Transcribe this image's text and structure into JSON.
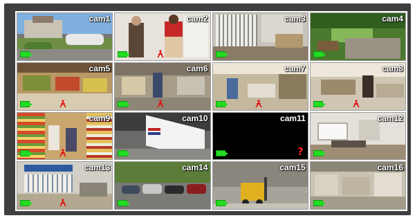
{
  "cameras": [
    {
      "label": "cam1",
      "signal": true,
      "motion": false
    },
    {
      "label": "cam2",
      "signal": true,
      "motion": true
    },
    {
      "label": "cam3",
      "signal": true,
      "motion": false
    },
    {
      "label": "cam4",
      "signal": true,
      "motion": false
    },
    {
      "label": "cam5",
      "signal": true,
      "motion": true
    },
    {
      "label": "cam6",
      "signal": true,
      "motion": true
    },
    {
      "label": "cam7",
      "signal": true,
      "motion": true
    },
    {
      "label": "cam8",
      "signal": true,
      "motion": true
    },
    {
      "label": "cam9",
      "signal": true,
      "motion": true
    },
    {
      "label": "cam10",
      "signal": true,
      "motion": false
    },
    {
      "label": "cam11",
      "signal": false,
      "motion": false
    },
    {
      "label": "cam12",
      "signal": true,
      "motion": false
    },
    {
      "label": "cam13",
      "signal": true,
      "motion": true
    },
    {
      "label": "cam14",
      "signal": true,
      "motion": false
    },
    {
      "label": "cam15",
      "signal": true,
      "motion": false
    },
    {
      "label": "cam16",
      "signal": true,
      "motion": false
    }
  ],
  "icons": {
    "record": "record-icon",
    "motion": "motion-person-icon",
    "no_signal": "question-mark-icon"
  },
  "colors": {
    "record": "#22dd22",
    "motion": "#e01010",
    "no_signal": "#ff2020",
    "frame": "#3f3f3f",
    "no_signal_bg": "#000000"
  }
}
